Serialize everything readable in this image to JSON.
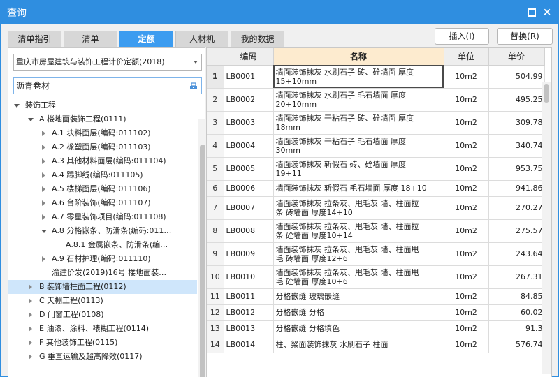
{
  "window": {
    "title": "查询",
    "maximize_icon": "maximize-icon",
    "close_glyph": "×"
  },
  "tabs": [
    "清单指引",
    "清单",
    "定额",
    "人材机",
    "我的数据"
  ],
  "active_tab": "定额",
  "buttons": {
    "insert": "插入(I)",
    "replace": "替换(R)"
  },
  "quota_library": "重庆市房屋建筑与装饰工程计价定额(2018)",
  "search": {
    "value": "沥青卷材",
    "icon": "search-icon"
  },
  "tree": [
    {
      "label": "装饰工程",
      "arrow": "expanded"
    },
    {
      "label": "A 楼地面装饰工程(0111)",
      "arrow": "expanded"
    },
    {
      "label": "A.1 块料面层(编码:011102)",
      "arrow": "collapsed"
    },
    {
      "label": "A.2 橡塑面层(编码:011103)",
      "arrow": "collapsed"
    },
    {
      "label": "A.3 其他材料面层(编码:011104)",
      "arrow": "collapsed"
    },
    {
      "label": "A.4 踢脚线(编码:011105)",
      "arrow": "collapsed"
    },
    {
      "label": "A.5 楼梯面层(编码:011106)",
      "arrow": "collapsed"
    },
    {
      "label": "A.6 台阶装饰(编码:011107)",
      "arrow": "collapsed"
    },
    {
      "label": "A.7 零星装饰项目(编码:011108)",
      "arrow": "collapsed"
    },
    {
      "label": "A.8 分格嵌条、防滑条(编码:011…",
      "arrow": "expanded"
    },
    {
      "label": "A.8.1 金属嵌条、防滑条(编…",
      "arrow": "none"
    },
    {
      "label": "A.9 石材护理(编码:011110)",
      "arrow": "collapsed"
    },
    {
      "label": "渝建价发(2019)16号 楼地面装…",
      "arrow": "none"
    },
    {
      "label": "B 装饰墙柱面工程(0112)",
      "arrow": "collapsed",
      "selected": true
    },
    {
      "label": "C 天棚工程(0113)",
      "arrow": "collapsed"
    },
    {
      "label": "D 门窗工程(0108)",
      "arrow": "collapsed"
    },
    {
      "label": "E 油漆、涂料、裱糊工程(0114)",
      "arrow": "collapsed"
    },
    {
      "label": "F 其他装饰工程(0115)",
      "arrow": "collapsed"
    },
    {
      "label": "G 垂直运输及超高降效(0117)",
      "arrow": "collapsed"
    }
  ],
  "grid": {
    "headers": {
      "code": "编码",
      "name": "名称",
      "unit": "单位",
      "price": "单价"
    },
    "rows": [
      {
        "no": "1",
        "code": "LB0001",
        "name": [
          "墙面装饰抹灰 水刷石子 砖、砼墙面 厚度",
          "15+10mm"
        ],
        "unit": "10m2",
        "price": "504.99"
      },
      {
        "no": "2",
        "code": "LB0002",
        "name": [
          "墙面装饰抹灰 水刷石子 毛石墙面 厚度",
          "20+10mm"
        ],
        "unit": "10m2",
        "price": "495.25"
      },
      {
        "no": "3",
        "code": "LB0003",
        "name": [
          "墙面装饰抹灰 干粘石子 砖、砼墙面 厚度",
          "18mm"
        ],
        "unit": "10m2",
        "price": "309.78"
      },
      {
        "no": "4",
        "code": "LB0004",
        "name": [
          "墙面装饰抹灰 干粘石子 毛石墙面 厚度",
          "30mm"
        ],
        "unit": "10m2",
        "price": "340.74"
      },
      {
        "no": "5",
        "code": "LB0005",
        "name": [
          "墙面装饰抹灰 斩假石 砖、砼墙面 厚度",
          "19+11"
        ],
        "unit": "10m2",
        "price": "953.75"
      },
      {
        "no": "6",
        "code": "LB0006",
        "name": [
          "墙面装饰抹灰 斩假石 毛石墙面 厚度 18+10"
        ],
        "unit": "10m2",
        "price": "941.86"
      },
      {
        "no": "7",
        "code": "LB0007",
        "name": [
          "墙面装饰抹灰 拉条灰、甩毛灰 墙、柱面拉",
          "条 砖墙面 厚度14+10"
        ],
        "unit": "10m2",
        "price": "270.27"
      },
      {
        "no": "8",
        "code": "LB0008",
        "name": [
          "墙面装饰抹灰 拉条灰、甩毛灰 墙、柱面拉",
          "条 砼墙面 厚度10+14"
        ],
        "unit": "10m2",
        "price": "275.57"
      },
      {
        "no": "9",
        "code": "LB0009",
        "name": [
          "墙面装饰抹灰 拉条灰、甩毛灰 墙、柱面甩",
          "毛 砖墙面 厚度12+6"
        ],
        "unit": "10m2",
        "price": "243.64"
      },
      {
        "no": "10",
        "code": "LB0010",
        "name": [
          "墙面装饰抹灰 拉条灰、甩毛灰 墙、柱面甩",
          "毛 砼墙面 厚度10+6"
        ],
        "unit": "10m2",
        "price": "267.31"
      },
      {
        "no": "11",
        "code": "LB0011",
        "name": [
          "分格嵌缝 玻璃嵌缝"
        ],
        "unit": "10m2",
        "price": "84.85"
      },
      {
        "no": "12",
        "code": "LB0012",
        "name": [
          "分格嵌缝 分格"
        ],
        "unit": "10m2",
        "price": "60.02"
      },
      {
        "no": "13",
        "code": "LB0013",
        "name": [
          "分格嵌缝 分格填色"
        ],
        "unit": "10m2",
        "price": "91.3"
      },
      {
        "no": "14",
        "code": "LB0014",
        "name": [
          "柱、梁面装饰抹灰 水刷石子 柱面"
        ],
        "unit": "10m2",
        "price": "576.74"
      }
    ]
  }
}
